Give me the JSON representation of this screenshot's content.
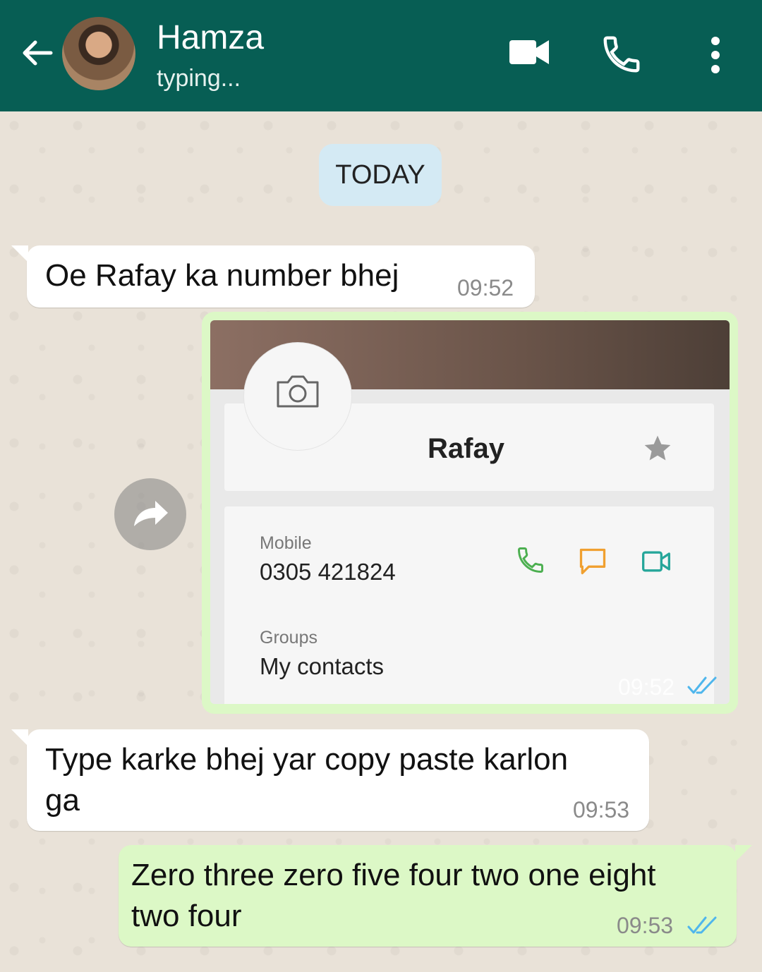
{
  "header": {
    "contact_name": "Hamza",
    "status": "typing...",
    "bg_color": "#075e54",
    "icons": [
      "back-arrow-icon",
      "video-call-icon",
      "voice-call-icon",
      "more-vert-icon"
    ]
  },
  "date_chip": "TODAY",
  "messages": [
    {
      "direction": "in",
      "text": "Oe Rafay ka number bhej",
      "time": "09:52"
    },
    {
      "direction": "out",
      "type": "image",
      "time": "09:52",
      "read": true
    },
    {
      "direction": "in",
      "line1": "Type karke bhej yar copy paste karlon",
      "line2": "ga",
      "time": "09:53"
    },
    {
      "direction": "out",
      "line1": "Zero three zero five four two one eight",
      "line2": "two four",
      "time": "09:53",
      "read": true
    }
  ],
  "shared_contact": {
    "name": "Rafay",
    "mobile_label": "Mobile",
    "mobile_number": "0305 421824",
    "groups_label": "Groups",
    "groups_value": "My contacts",
    "icons": [
      "camera-icon",
      "star-icon",
      "call-icon",
      "message-icon",
      "video-icon"
    ]
  },
  "colors": {
    "outgoing_bubble": "#dcf8c6",
    "incoming_bubble": "#ffffff",
    "read_ticks": "#4fb6ec"
  }
}
